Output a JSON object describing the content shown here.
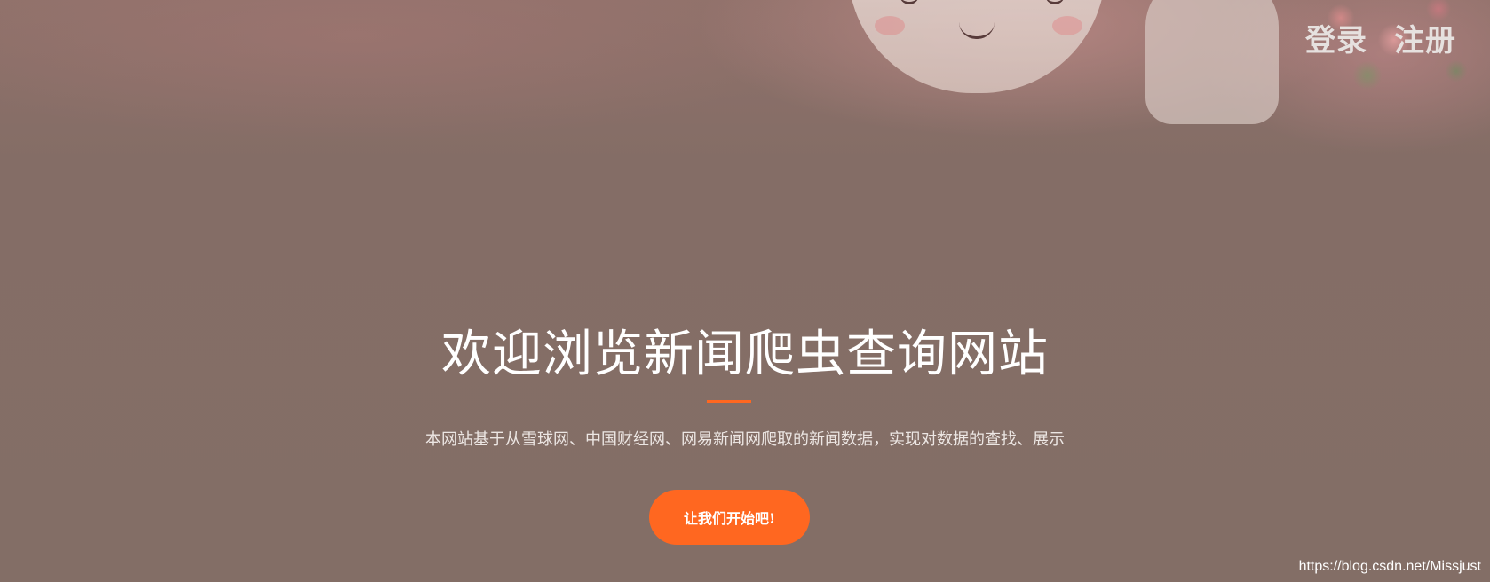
{
  "nav": {
    "login_label": "登录",
    "register_label": "注册"
  },
  "hero": {
    "title": "欢迎浏览新闻爬虫查询网站",
    "subtitle": "本网站基于从雪球网、中国财经网、网易新闻网爬取的新闻数据，实现对数据的查找、展示",
    "cta_label": "让我们开始吧!"
  },
  "watermark": "https://blog.csdn.net/Missjust",
  "colors": {
    "accent": "#ff6720",
    "overlay": "#836e66",
    "text": "#ffffff"
  },
  "icons": [
    "cartoon-face-decoration",
    "ghost-decoration",
    "flower-bouquet-decoration"
  ]
}
